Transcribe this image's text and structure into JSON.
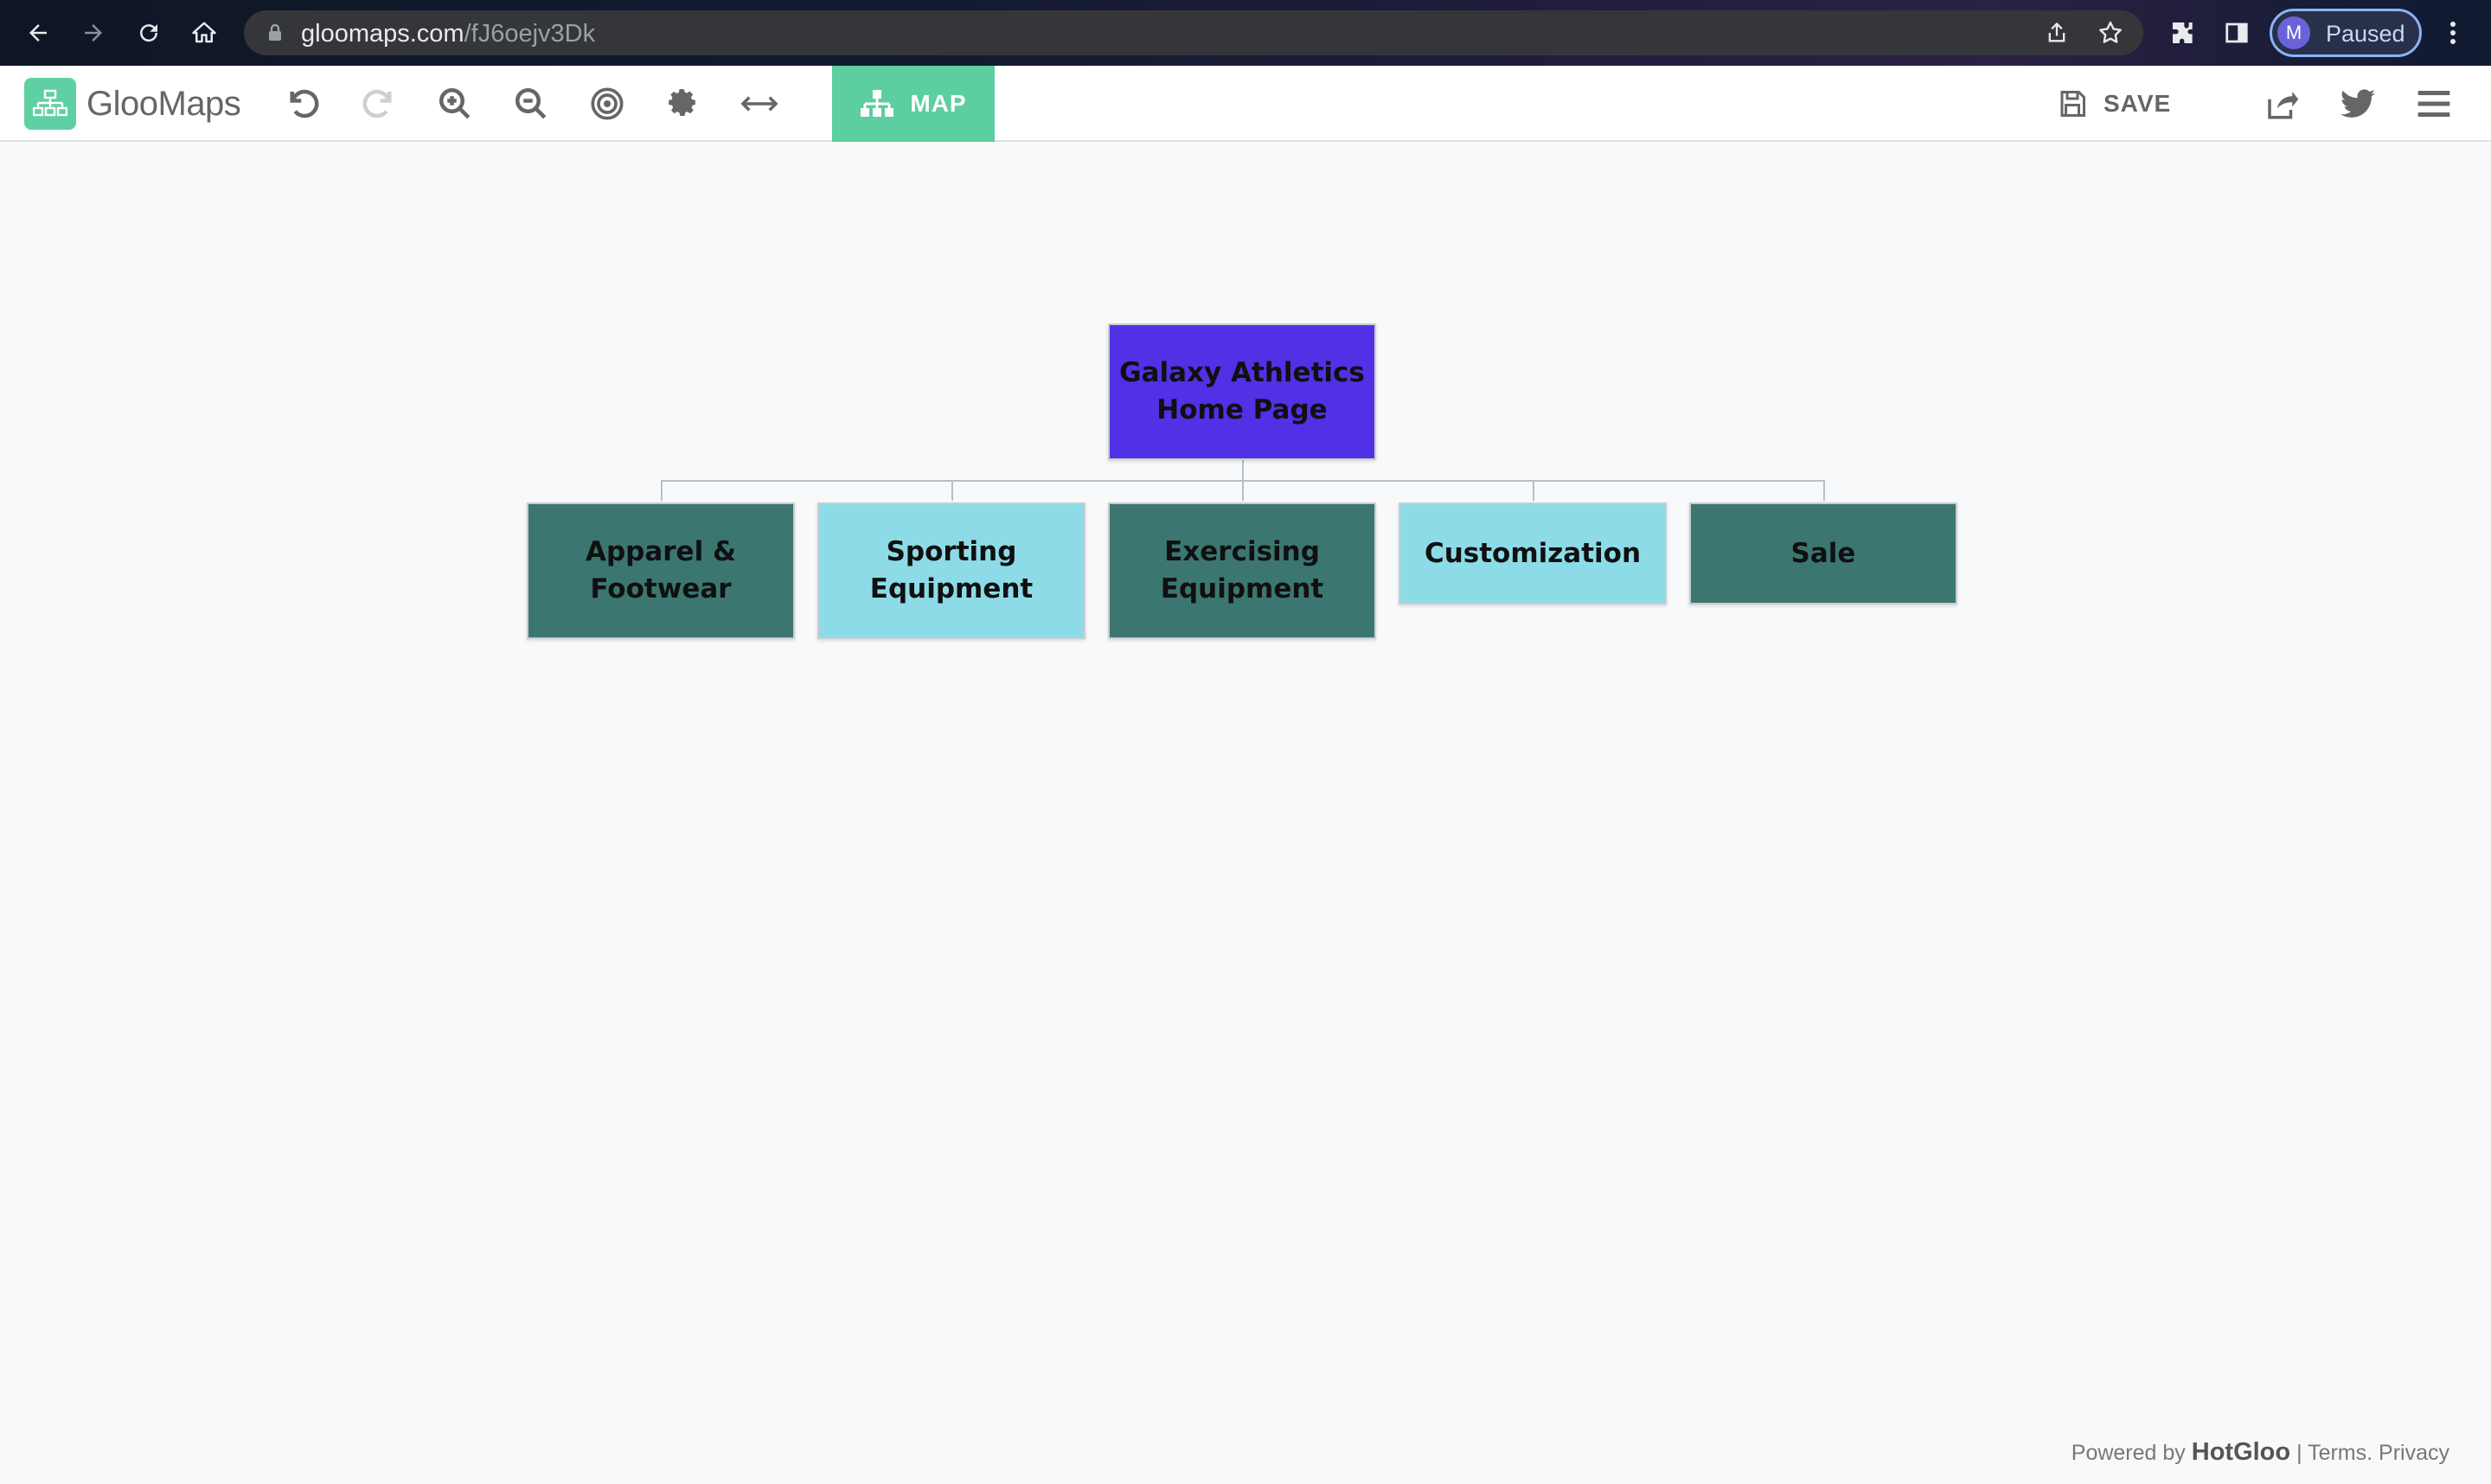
{
  "browser": {
    "url_host": "gloomaps.com",
    "url_path": "/fJ6oejv3Dk",
    "profile_initial": "M",
    "profile_status": "Paused"
  },
  "app": {
    "logo_text": "GlooMaps",
    "map_label": "MAP",
    "save_label": "SAVE",
    "brand_color": "#5ccea0"
  },
  "sitemap": {
    "root": {
      "label": "Galaxy Athletics\nHome Page",
      "color": "#5230e6"
    },
    "children": [
      {
        "label": "Apparel &\nFootwear",
        "color": "#3c7671"
      },
      {
        "label": "Sporting\nEquipment",
        "color": "#8ddbe7"
      },
      {
        "label": "Exercising\nEquipment",
        "color": "#3c7671"
      },
      {
        "label": "Customization",
        "color": "#8ddbe7"
      },
      {
        "label": "Sale",
        "color": "#3c7671"
      }
    ]
  },
  "footer": {
    "powered_by": "Powered by",
    "brand": "HotGloo",
    "sep1": "|",
    "terms": "Terms",
    "sep2": ".",
    "privacy": "Privacy"
  }
}
